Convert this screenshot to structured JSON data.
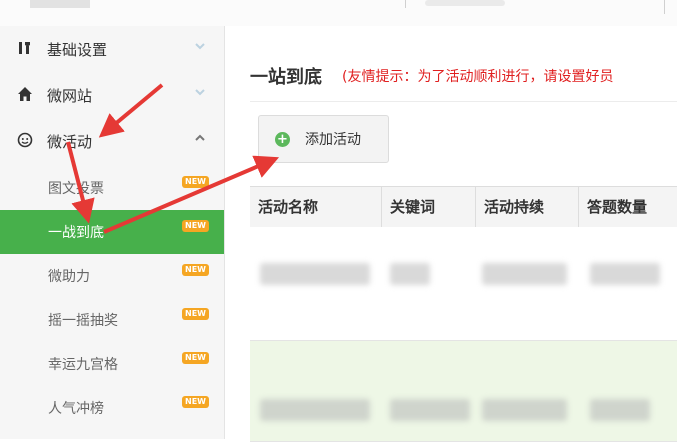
{
  "sidebar": {
    "menus": [
      {
        "label": "基础设置",
        "icon": "wrench-icon",
        "expanded": false
      },
      {
        "label": "微网站",
        "icon": "home-icon",
        "expanded": false
      },
      {
        "label": "微活动",
        "icon": "face-icon",
        "expanded": true
      }
    ],
    "items": [
      {
        "label": "图文投票",
        "badge": "NEW",
        "active": false
      },
      {
        "label": "一战到底",
        "badge": "NEW",
        "active": true
      },
      {
        "label": "微助力",
        "badge": "NEW",
        "active": false
      },
      {
        "label": "摇一摇抽奖",
        "badge": "NEW",
        "active": false
      },
      {
        "label": "幸运九宫格",
        "badge": "NEW",
        "active": false
      },
      {
        "label": "人气冲榜",
        "badge": "NEW",
        "active": false
      }
    ]
  },
  "main": {
    "title": "一站到底",
    "tip": "(友情提示：为了活动顺利进行，请设置好员",
    "add_button": "添加活动",
    "table": {
      "columns": [
        "活动名称",
        "关键词",
        "活动持续",
        "答题数量"
      ]
    }
  },
  "colors": {
    "active_green": "#47b04b",
    "badge_orange": "#f5a623",
    "tip_red": "#e02020",
    "arrow_red": "#e53935",
    "row_highlight": "#eef7e6"
  }
}
